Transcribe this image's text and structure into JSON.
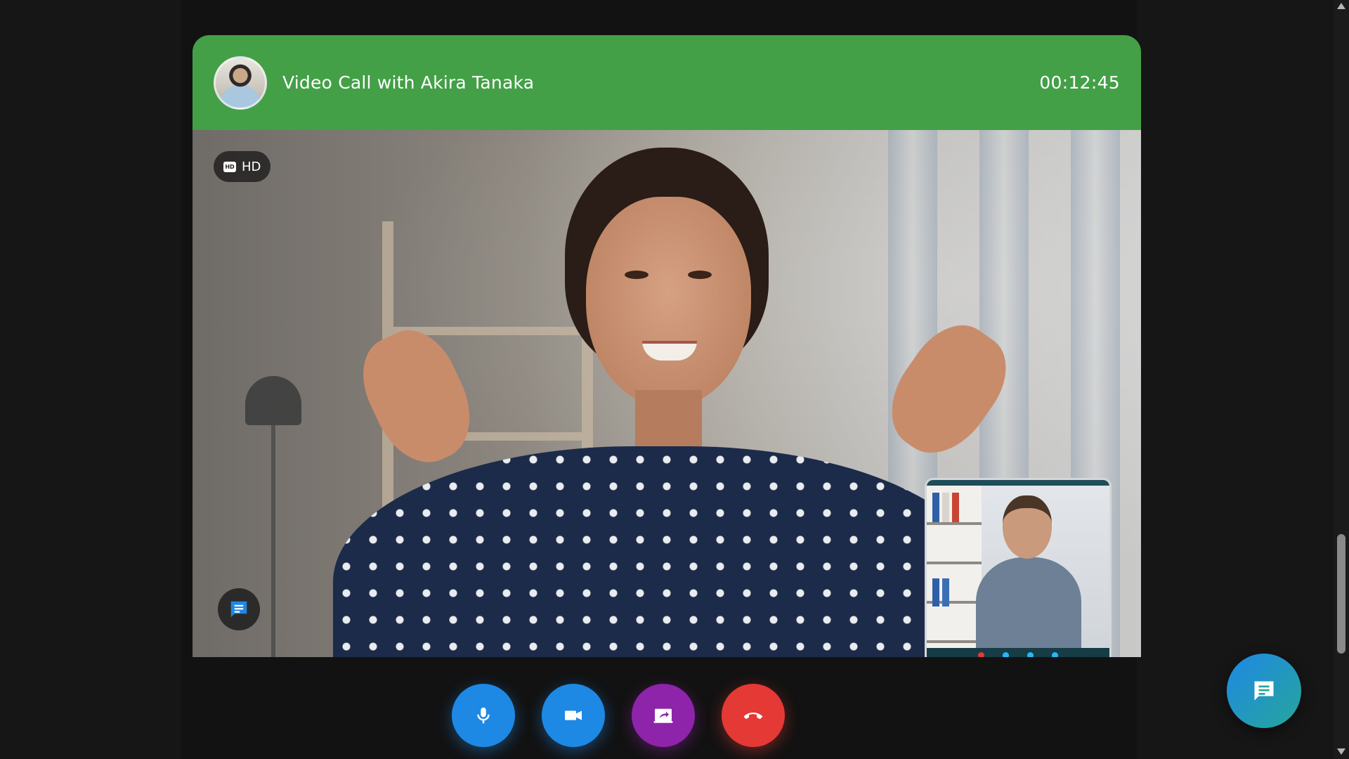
{
  "header": {
    "title": "Video Call with Akira Tanaka",
    "timer": "00:12:45",
    "avatar_icon": "caller-avatar",
    "color": "#43a047"
  },
  "video": {
    "quality_badge": "HD",
    "quality_icon": "hd-icon",
    "chat_icon": "chat-bubble-icon"
  },
  "self_view": {
    "mini_controls": [
      "end-call-icon",
      "camera-icon",
      "mic-icon",
      "share-icon"
    ]
  },
  "controls": {
    "mic": {
      "icon": "microphone-icon",
      "color": "#1e88e5"
    },
    "camera": {
      "icon": "video-camera-icon",
      "color": "#1e88e5"
    },
    "share": {
      "icon": "screen-share-icon",
      "color": "#8e24aa"
    },
    "end": {
      "icon": "phone-hangup-icon",
      "color": "#e53935"
    }
  },
  "floating_chat": {
    "icon": "chat-bubble-icon"
  }
}
